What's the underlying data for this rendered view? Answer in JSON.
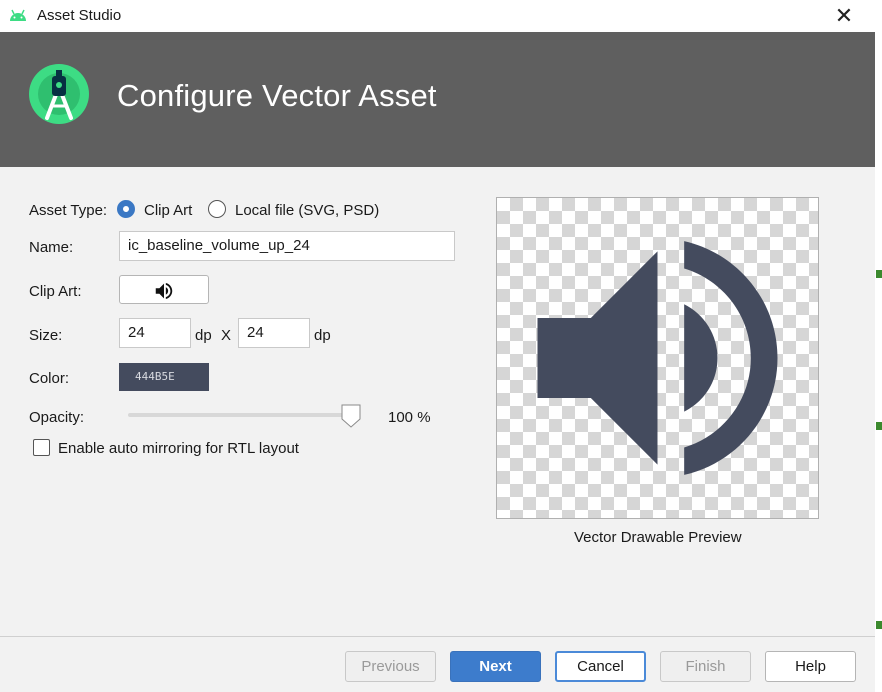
{
  "window": {
    "title": "Asset Studio",
    "close_glyph": "✕"
  },
  "banner": {
    "heading": "Configure Vector Asset"
  },
  "form": {
    "asset_type_label": "Asset Type:",
    "asset_type_options": [
      "Clip Art",
      "Local file (SVG, PSD)"
    ],
    "asset_type_selected": "Clip Art",
    "name_label": "Name:",
    "name_value": "ic_baseline_volume_up_24",
    "clip_art_label": "Clip Art:",
    "clip_art_icon": "volume-up-icon",
    "size_label": "Size:",
    "width_value": "24",
    "height_value": "24",
    "unit": "dp",
    "size_separator": "X",
    "color_label": "Color:",
    "color_value": "444B5E",
    "opacity_label": "Opacity:",
    "opacity_value": "100 %",
    "opacity_fraction": 1.0,
    "auto_mirror_label": "Enable auto mirroring for RTL layout",
    "auto_mirror_checked": false
  },
  "preview": {
    "caption": "Vector Drawable Preview",
    "icon": "volume-up-icon",
    "icon_color": "#444B5E"
  },
  "buttons": {
    "previous": "Previous",
    "next": "Next",
    "cancel": "Cancel",
    "finish": "Finish",
    "help": "Help"
  },
  "colors": {
    "banner_bg": "#5f5f5f",
    "accent": "#3d7ccc",
    "icon": "#444B5E"
  }
}
